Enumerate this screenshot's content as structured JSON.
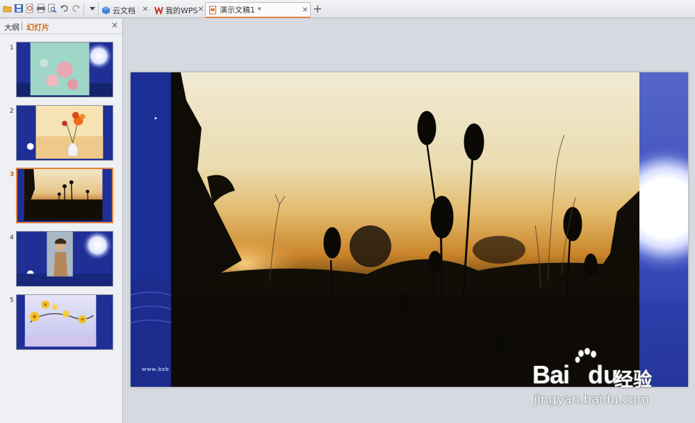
{
  "tabs": [
    {
      "label": "云文档",
      "icon": "cloud-doc-icon"
    },
    {
      "label": "我的WPS",
      "icon": "wps-logo-icon"
    },
    {
      "label": "演示文稿1 *",
      "icon": "presentation-doc-icon"
    }
  ],
  "toolbar_icons": [
    "open-folder-icon",
    "save-icon",
    "export-pdf-icon",
    "print-icon",
    "print-preview-icon",
    "undo-icon",
    "redo-icon",
    "more-dropdown-icon"
  ],
  "panel": {
    "outline_label": "大纲",
    "slides_label": "幻灯片"
  },
  "slides": [
    {
      "number": "1",
      "content": "flowers-photo"
    },
    {
      "number": "2",
      "content": "vase-flowers"
    },
    {
      "number": "3",
      "content": "sunset-silhouette",
      "selected": true
    },
    {
      "number": "4",
      "content": "man-portrait"
    },
    {
      "number": "5",
      "content": "yellow-flowers"
    }
  ],
  "current_slide": {
    "footer_url": "www.bzb"
  },
  "watermark": {
    "logo_text_1": "Bai",
    "logo_text_2": "du",
    "logo_text_3": "经验",
    "url": "jingyan.baidu.com"
  },
  "colors": {
    "accent": "#e2823c",
    "slide_blue": "#1a2e94"
  }
}
